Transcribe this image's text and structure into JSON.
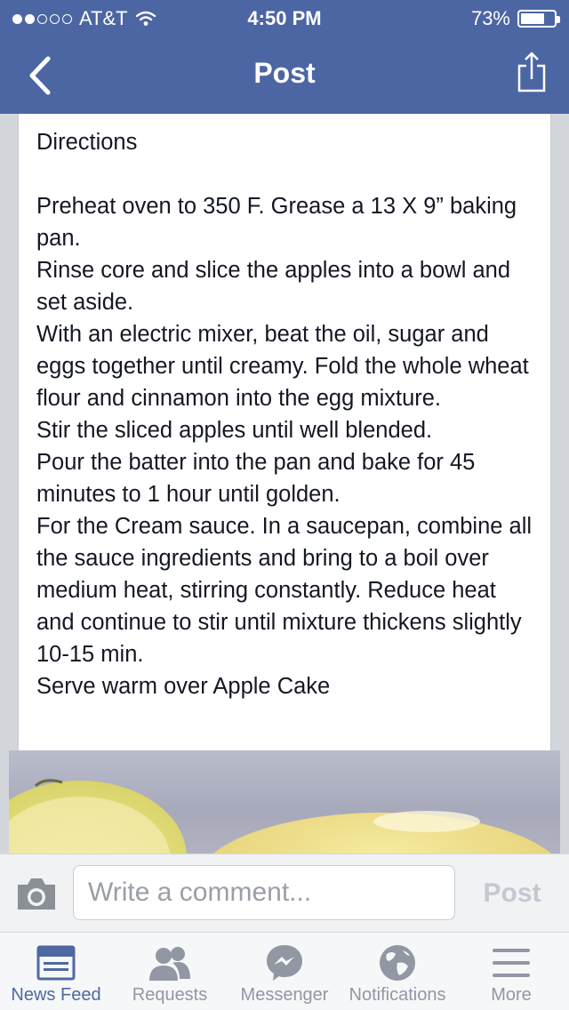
{
  "status_bar": {
    "carrier": "AT&T",
    "time": "4:50 PM",
    "battery": "73%",
    "battery_level": 0.73
  },
  "nav": {
    "title": "Post",
    "back_icon": "chevron-left-icon",
    "share_icon": "share-icon"
  },
  "post": {
    "heading": "Directions",
    "paragraphs": [
      "Preheat oven to 350 F. Grease a 13 X 9” baking pan.",
      "Rinse core and slice the apples into a bowl and set aside.",
      "With an electric mixer, beat the oil, sugar and eggs together until creamy. Fold the whole wheat flour and cinnamon into the egg mixture.",
      "Stir the sliced apples until well blended.",
      "Pour the batter into the pan and bake for 45 minutes to 1 hour until golden.",
      "For the Cream sauce. In a saucepan, combine all the sauce ingredients and bring to a boil over medium heat, stirring constantly. Reduce heat and continue to stir until mixture thickens slightly 10-15 min.",
      "Serve warm over Apple Cake"
    ]
  },
  "comment_bar": {
    "placeholder": "Write a comment...",
    "post_label": "Post",
    "camera_icon": "camera-icon"
  },
  "tabs": [
    {
      "label": "News Feed",
      "icon": "news-feed-icon",
      "active": true
    },
    {
      "label": "Requests",
      "icon": "requests-icon",
      "active": false
    },
    {
      "label": "Messenger",
      "icon": "messenger-icon",
      "active": false
    },
    {
      "label": "Notifications",
      "icon": "globe-icon",
      "active": false
    },
    {
      "label": "More",
      "icon": "menu-icon",
      "active": false
    }
  ],
  "colors": {
    "brand": "#4c66a4",
    "active_tab": "#4e69a2",
    "inactive_tab": "#9197a3"
  }
}
